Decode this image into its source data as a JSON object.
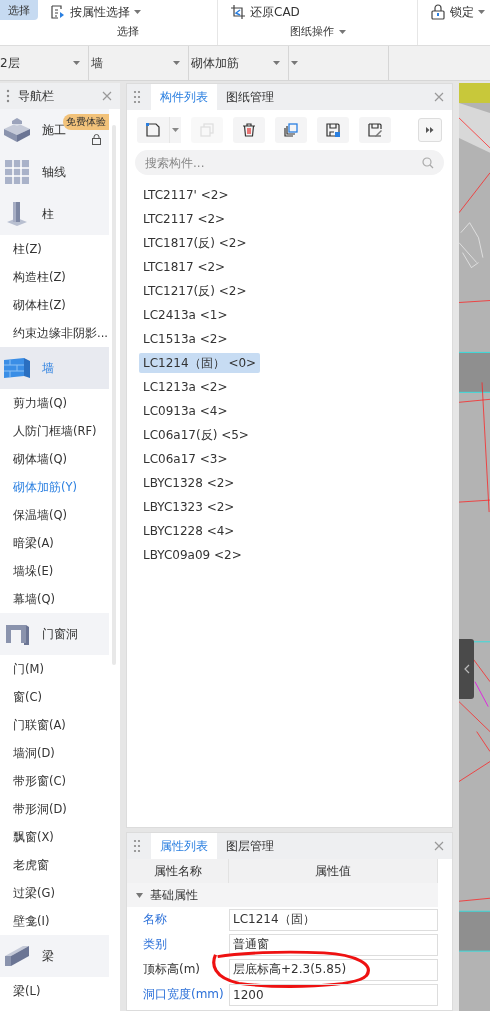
{
  "ribbon": {
    "select_button": "选择",
    "groups": [
      {
        "label": "选择",
        "dropdown": false,
        "tools": [
          {
            "kind": "filter",
            "label": "按属性选择",
            "dropdown": true
          }
        ]
      },
      {
        "label": "图纸操作",
        "dropdown": true,
        "tools": [
          {
            "kind": "restore",
            "label": "还原CAD",
            "dropdown": false
          }
        ]
      },
      {
        "tools": [
          {
            "kind": "lock",
            "label": "锁定",
            "dropdown": true
          }
        ]
      }
    ]
  },
  "filters": [
    {
      "value": "2层"
    },
    {
      "value": "墙"
    },
    {
      "value": "砌体加筋"
    },
    {
      "kind": "blank"
    }
  ],
  "navigator": {
    "title": "导航栏",
    "categories": [
      {
        "kind": "stage",
        "label": "施工",
        "selected": false,
        "badge": "免费体验",
        "locked": true
      },
      {
        "kind": "grid",
        "label": "轴线",
        "selected": false
      },
      {
        "kind": "column",
        "label": "柱",
        "selected": false,
        "children": [
          {
            "label": "柱(Z)",
            "selected": false
          },
          {
            "label": "构造柱(Z)",
            "selected": false
          },
          {
            "label": "砌体柱(Z)",
            "selected": false
          },
          {
            "label": "约束边缘非阴影...",
            "selected": false
          }
        ]
      },
      {
        "kind": "wall",
        "label": "墙",
        "selected": true,
        "children": [
          {
            "label": "剪力墙(Q)",
            "selected": false
          },
          {
            "label": "人防门框墙(RF)",
            "selected": false
          },
          {
            "label": "砌体墙(Q)",
            "selected": false
          },
          {
            "label": "砌体加筋(Y)",
            "selected": true
          },
          {
            "label": "保温墙(Q)",
            "selected": false
          },
          {
            "label": "暗梁(A)",
            "selected": false
          },
          {
            "label": "墙垛(E)",
            "selected": false
          },
          {
            "label": "幕墙(Q)",
            "selected": false
          }
        ]
      },
      {
        "kind": "opening",
        "label": "门窗洞",
        "selected": false,
        "children": [
          {
            "label": "门(M)",
            "selected": false
          },
          {
            "label": "窗(C)",
            "selected": false
          },
          {
            "label": "门联窗(A)",
            "selected": false
          },
          {
            "label": "墙洞(D)",
            "selected": false
          },
          {
            "label": "带形窗(C)",
            "selected": false
          },
          {
            "label": "带形洞(D)",
            "selected": false
          },
          {
            "label": "飘窗(X)",
            "selected": false
          },
          {
            "label": "老虎窗",
            "selected": false
          },
          {
            "label": "过梁(G)",
            "selected": false
          },
          {
            "label": "壁龛(I)",
            "selected": false
          }
        ]
      },
      {
        "kind": "beam",
        "label": "梁",
        "selected": false,
        "children": [
          {
            "label": "梁(L)",
            "selected": false
          }
        ]
      }
    ]
  },
  "component_panel": {
    "tabs": [
      {
        "label": "构件列表",
        "selected": true
      },
      {
        "label": "图纸管理",
        "selected": false
      }
    ],
    "toolbar": [
      {
        "kind": "new",
        "disabled": false,
        "dropdown": true
      },
      {
        "kind": "copy",
        "disabled": true
      },
      {
        "kind": "delete",
        "disabled": false
      },
      {
        "kind": "duplicate",
        "disabled": false
      },
      {
        "kind": "save",
        "disabled": false
      },
      {
        "kind": "edit",
        "disabled": false
      }
    ],
    "search": {
      "placeholder": "搜索构件..."
    },
    "items": [
      {
        "label": "LTC2117' <2>",
        "selected": false
      },
      {
        "label": "LTC2117 <2>",
        "selected": false
      },
      {
        "label": "LTC1817(反) <2>",
        "selected": false
      },
      {
        "label": "LTC1817 <2>",
        "selected": false
      },
      {
        "label": "LTC1217(反) <2>",
        "selected": false
      },
      {
        "label": "LC2413a <1>",
        "selected": false
      },
      {
        "label": "LC1513a <2>",
        "selected": false
      },
      {
        "label": "LC1214（固） <0>",
        "selected": true
      },
      {
        "label": "LC1213a <2>",
        "selected": false
      },
      {
        "label": "LC0913a <4>",
        "selected": false
      },
      {
        "label": "LC06a17(反) <5>",
        "selected": false
      },
      {
        "label": "LC06a17 <3>",
        "selected": false
      },
      {
        "label": "LBYC1328 <2>",
        "selected": false
      },
      {
        "label": "LBYC1323 <2>",
        "selected": false
      },
      {
        "label": "LBYC1228 <4>",
        "selected": false
      },
      {
        "label": "LBYC09a09 <2>",
        "selected": false
      }
    ]
  },
  "property_panel": {
    "tabs": [
      {
        "label": "属性列表",
        "selected": true
      },
      {
        "label": "图层管理",
        "selected": false
      }
    ],
    "columns": [
      "属性名称",
      "属性值"
    ],
    "group": {
      "label": "基础属性",
      "expanded": true
    },
    "rows": [
      {
        "name": "名称",
        "value": "LC1214（固）",
        "linked": true,
        "circled": false
      },
      {
        "name": "类别",
        "value": "普通窗",
        "linked": true,
        "circled": false
      },
      {
        "name": "顶标高(m)",
        "value": "层底标高+2.3(5.85)",
        "linked": false,
        "circled": true
      },
      {
        "name": "洞口宽度(mm)",
        "value": "1200",
        "linked": true,
        "circled": false
      }
    ]
  }
}
